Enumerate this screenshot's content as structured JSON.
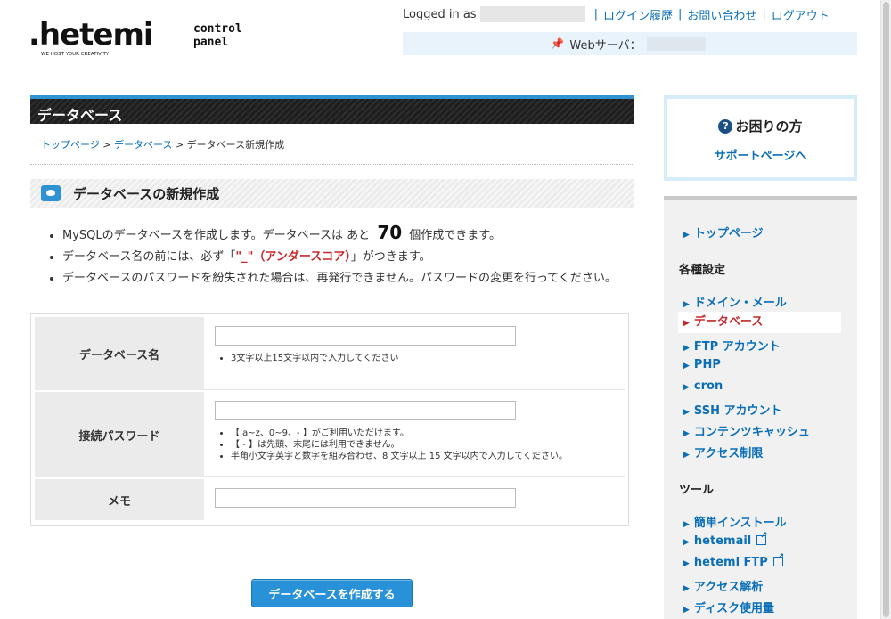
{
  "header": {
    "logo_main": ".hetemi",
    "logo_sub": "control panel",
    "logo_tagline": "WE HOST YOUR CREATIVITY",
    "logged_in_label": "Logged in as",
    "links": [
      "ログイン履歴",
      "お問い合わせ",
      "ログアウト"
    ],
    "server_label": "Webサーバ："
  },
  "main": {
    "title": "データベース",
    "breadcrumb": [
      "トップページ",
      "データベース",
      "データベース新規作成"
    ],
    "section_title": "データベースの新規作成",
    "notes": {
      "n1_pre": "MySQLのデータベースを作成します。データベースは あと",
      "n1_count": "70",
      "n1_post": "個作成できます。",
      "n2_pre": "データベース名の前には、必ず「",
      "n2_red": "\"_\"（アンダースコア）",
      "n2_post": "」がつきます。",
      "n3": "データベースのパスワードを紛失された場合は、再発行できません。パスワードの変更を行ってください。"
    },
    "form": {
      "db_name_label": "データベース名",
      "db_name_value": "",
      "db_name_hint": "3文字以上15文字以内で入力してください",
      "password_label": "接続パスワード",
      "password_value": "",
      "password_hints": [
        "【 a~z、0~9、- 】がご利用いただけます。",
        "【 - 】は先頭、末尾には利用できません。",
        "半角小文字英字と数字を組み合わせ、8 文字以上 15 文字以内で入力してください。"
      ],
      "memo_label": "メモ",
      "memo_value": ""
    },
    "submit_label": "データベースを作成する"
  },
  "sidebar": {
    "help_title": "お困りの方",
    "help_link": "サポートページへ",
    "top_link": "トップページ",
    "group1_title": "各種設定",
    "group1_items": [
      "ドメイン・メール",
      "データベース",
      "FTP アカウント",
      "PHP",
      "cron",
      "SSH アカウント",
      "コンテンツキャッシュ",
      "アクセス制限"
    ],
    "group2_title": "ツール",
    "group2_items": [
      "簡単インストール",
      "hetemail",
      "heteml FTP",
      "アクセス解析",
      "ディスク使用量"
    ]
  },
  "colors": {
    "accent": "#2e92d3",
    "link": "#0a6fb8",
    "active": "#c62828"
  }
}
